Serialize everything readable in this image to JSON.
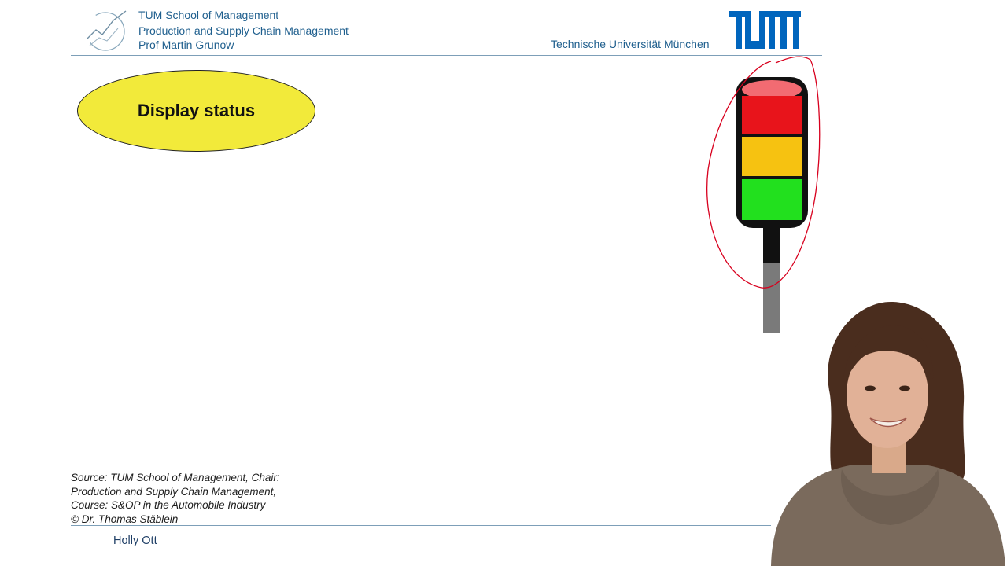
{
  "header": {
    "school": "TUM School of Management",
    "chair": "Production and Supply Chain Management",
    "professor": "Prof Martin Grunow",
    "university": "Technische Universität München",
    "logo_icon": "tum-logo-icon"
  },
  "slide": {
    "title": "Display status",
    "title_color": "#f2ea3a",
    "traffic_light": {
      "lights": [
        "red",
        "yellow",
        "green"
      ],
      "colors": {
        "top_cap": "#f26b72",
        "red": "#e8141b",
        "yellow": "#f6c211",
        "green": "#22e01e"
      },
      "annotation_color": "#d8001e"
    }
  },
  "source": {
    "lines": [
      "Source: TUM School of Management, Chair:",
      "Production and Supply Chain Management,",
      "Course: S&OP in the Automobile Industry",
      "© Dr. Thomas Stäblein"
    ]
  },
  "footer": {
    "presenter_name": "Holly Ott"
  },
  "colors": {
    "accent": "#1f5f8e",
    "tum_blue": "#0065bd"
  }
}
